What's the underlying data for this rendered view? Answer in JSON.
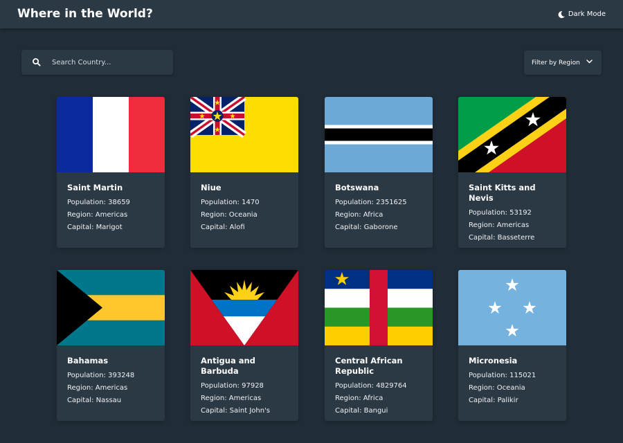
{
  "header": {
    "title": "Where in the World?",
    "mode_label": "Dark Mode"
  },
  "search": {
    "placeholder": "Search Country..."
  },
  "filter": {
    "label": "Filter by Region"
  },
  "labels": {
    "population": "Population:",
    "region": "Region:",
    "capital": "Capital:"
  },
  "countries": [
    {
      "name": "Saint Martin",
      "population": "38659",
      "region": "Americas",
      "capital": "Marigot"
    },
    {
      "name": "Niue",
      "population": "1470",
      "region": "Oceania",
      "capital": "Alofi"
    },
    {
      "name": "Botswana",
      "population": "2351625",
      "region": "Africa",
      "capital": "Gaborone"
    },
    {
      "name": "Saint Kitts and Nevis",
      "population": "53192",
      "region": "Americas",
      "capital": "Basseterre"
    },
    {
      "name": "Bahamas",
      "population": "393248",
      "region": "Americas",
      "capital": "Nassau"
    },
    {
      "name": "Antigua and Barbuda",
      "population": "97928",
      "region": "Americas",
      "capital": "Saint John's"
    },
    {
      "name": "Central African Republic",
      "population": "4829764",
      "region": "Africa",
      "capital": "Bangui"
    },
    {
      "name": "Micronesia",
      "population": "115021",
      "region": "Oceania",
      "capital": "Palikir"
    }
  ],
  "colors": {
    "background": "#202c37",
    "element": "#2b3945",
    "text": "#ffffff"
  }
}
